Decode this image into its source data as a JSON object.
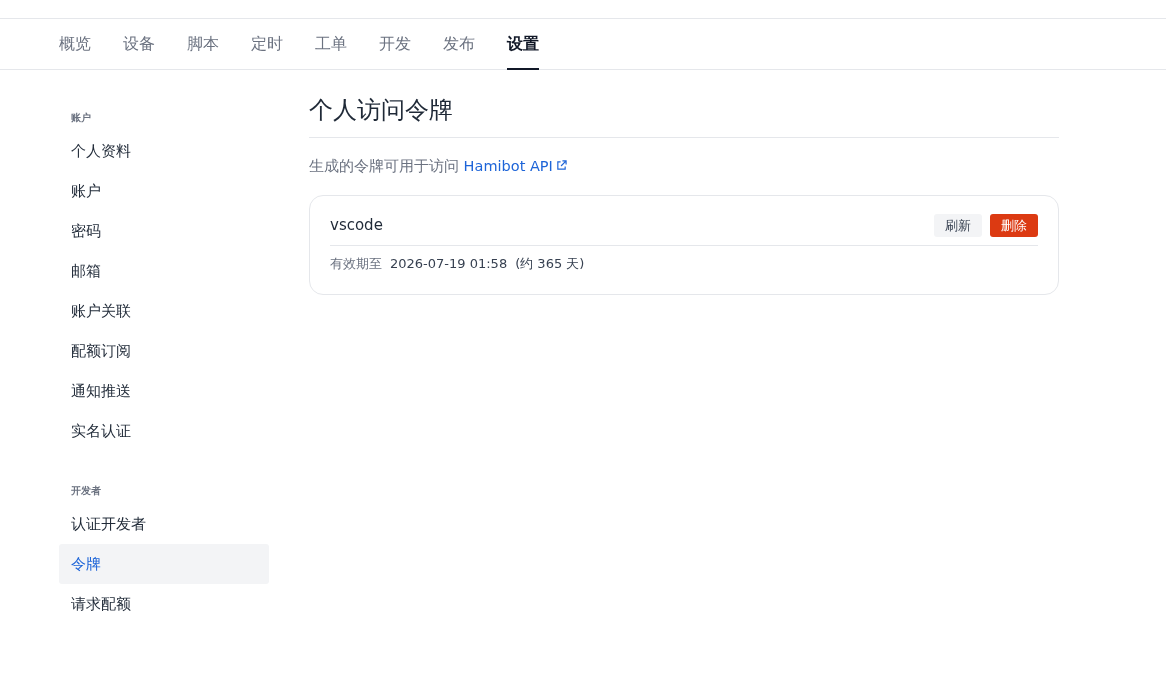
{
  "tabs": [
    {
      "label": "概览",
      "selected": false
    },
    {
      "label": "设备",
      "selected": false
    },
    {
      "label": "脚本",
      "selected": false
    },
    {
      "label": "定时",
      "selected": false
    },
    {
      "label": "工单",
      "selected": false
    },
    {
      "label": "开发",
      "selected": false
    },
    {
      "label": "发布",
      "selected": false
    },
    {
      "label": "设置",
      "selected": true
    }
  ],
  "sidebar": {
    "sections": [
      {
        "heading": "账户",
        "items": [
          {
            "label": "个人资料",
            "selected": false
          },
          {
            "label": "账户",
            "selected": false
          },
          {
            "label": "密码",
            "selected": false
          },
          {
            "label": "邮箱",
            "selected": false
          },
          {
            "label": "账户关联",
            "selected": false
          },
          {
            "label": "配额订阅",
            "selected": false
          },
          {
            "label": "通知推送",
            "selected": false
          },
          {
            "label": "实名认证",
            "selected": false
          }
        ]
      },
      {
        "heading": "开发者",
        "items": [
          {
            "label": "认证开发者",
            "selected": false
          },
          {
            "label": "令牌",
            "selected": true
          },
          {
            "label": "请求配额",
            "selected": false
          }
        ]
      }
    ]
  },
  "page": {
    "title": "个人访问令牌",
    "description": "生成的令牌可用于访问",
    "link": "Hamibot API"
  },
  "tokens": [
    {
      "name": "vscode",
      "expiry_label": "有效期至",
      "expiry": "2026-07-19 01:58",
      "remaining": "(约 365 天)",
      "buttons": [
        {
          "label": "刷新",
          "kind": "secondary"
        },
        {
          "label": "删除",
          "kind": "danger"
        }
      ]
    }
  ]
}
